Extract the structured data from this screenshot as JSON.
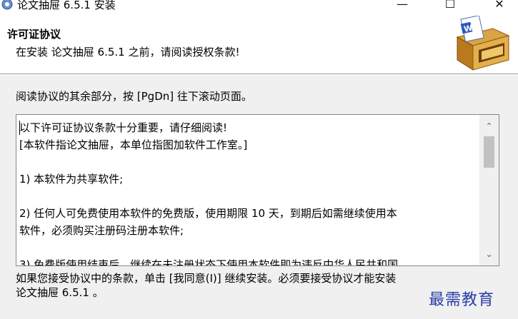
{
  "window": {
    "title": "论文抽屉 6.5.1 安装",
    "minimize_glyph": "—",
    "maximize_glyph": "☐",
    "close_glyph": "✕"
  },
  "header": {
    "title": "许可证协议",
    "subtitle": "在安装 论文抽屉 6.5.1 之前，请阅读授权条款!"
  },
  "instruction": "阅读协议的其余部分，按 [PgDn] 往下滚动页面。",
  "license": {
    "lines": [
      "以下许可证协议条款十分重要，请仔细阅读!",
      "[本软件指论文抽屉，本单位指图加软件工作室。]",
      "",
      "1) 本软件为共享软件;",
      "",
      "2) 任何人可免费使用本软件的免费版，使用期限 10 天，到期后如需继续使用本",
      "软件，必须购买注册码注册本软件;",
      "",
      "3) 免费版使用结束后，继续在未注册状态下使用本软件即为违反中华人民共和国"
    ]
  },
  "scrollbar": {
    "up_glyph": "⌃",
    "down_glyph": "⌄"
  },
  "footer": {
    "line1": "如果您接受协议中的条款，单击 [我同意(I)] 继续安装。必须要接受协议才能安装",
    "line2": "论文抽屉 6.5.1 。"
  },
  "watermark": "最需教育"
}
